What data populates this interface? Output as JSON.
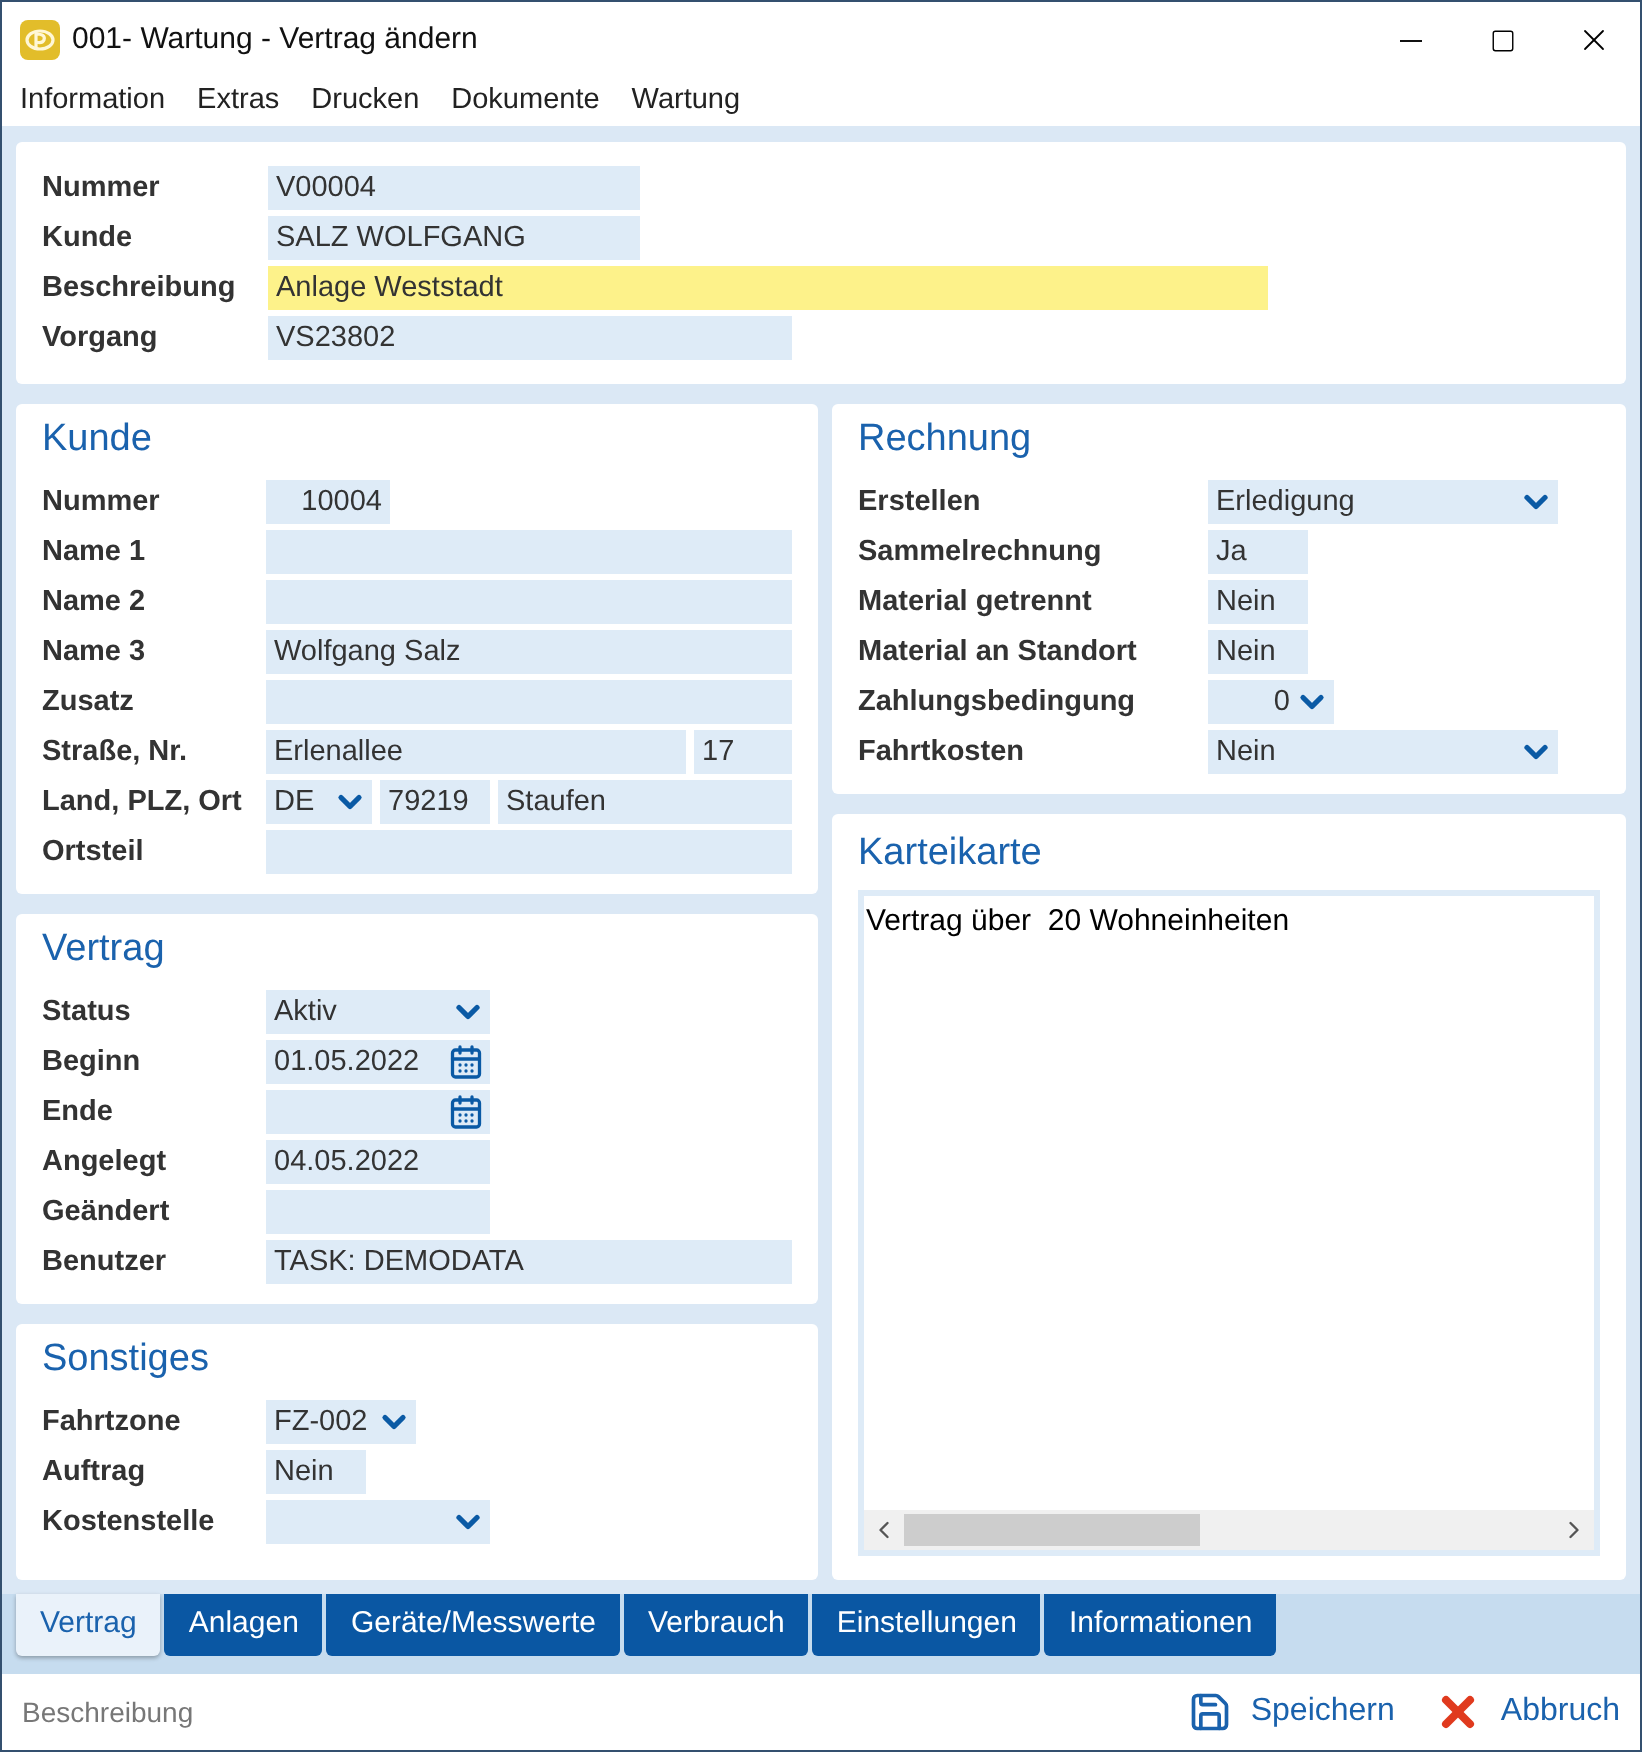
{
  "window": {
    "title": "001- Wartung - Vertrag ändern"
  },
  "menu": [
    "Information",
    "Extras",
    "Drucken",
    "Dokumente",
    "Wartung"
  ],
  "header": {
    "fields": [
      {
        "label": "Nummer",
        "value": "V00004",
        "focused": false
      },
      {
        "label": "Kunde",
        "value": "SALZ WOLFGANG",
        "focused": false
      },
      {
        "label": "Beschreibung",
        "value": "Anlage Weststadt",
        "focused": true
      },
      {
        "label": "Vorgang",
        "value": "VS23802",
        "focused": false
      }
    ]
  },
  "left_sections": [
    {
      "title": "Kunde",
      "fields": [
        {
          "label": "Nummer",
          "inputs": [
            {
              "kind": "number",
              "value": "10004"
            }
          ]
        },
        {
          "label": "Name 1",
          "inputs": [
            {
              "kind": "text"
            }
          ]
        },
        {
          "label": "Name 2",
          "inputs": [
            {
              "kind": "text"
            }
          ]
        },
        {
          "label": "Name 3",
          "inputs": [
            {
              "kind": "text",
              "value": "Wolfgang Salz"
            }
          ]
        },
        {
          "label": "Zusatz",
          "inputs": [
            {
              "kind": "text"
            }
          ]
        },
        {
          "label": "Straße, Nr.",
          "inputs": [
            {
              "kind": "text",
              "value": "Erlenallee"
            },
            {
              "kind": "text",
              "value": "17"
            }
          ]
        },
        {
          "label": "Land, PLZ, Ort",
          "inputs": [
            {
              "kind": "select",
              "value": "DE"
            },
            {
              "kind": "text",
              "value": "79219"
            },
            {
              "kind": "text",
              "value": "Staufen"
            }
          ]
        },
        {
          "label": "Ortsteil",
          "inputs": [
            {
              "kind": "text"
            }
          ]
        }
      ]
    },
    {
      "title": "Vertrag",
      "fields": [
        {
          "label": "Status",
          "inputs": [
            {
              "kind": "select",
              "value": "Aktiv"
            }
          ]
        },
        {
          "label": "Beginn",
          "inputs": [
            {
              "kind": "date",
              "value": "01.05.2022"
            }
          ]
        },
        {
          "label": "Ende",
          "inputs": [
            {
              "kind": "date"
            }
          ]
        },
        {
          "label": "Angelegt",
          "inputs": [
            {
              "kind": "text",
              "value": "04.05.2022"
            }
          ]
        },
        {
          "label": "Geändert",
          "inputs": [
            {
              "kind": "text"
            }
          ]
        },
        {
          "label": "Benutzer",
          "inputs": [
            {
              "kind": "text",
              "value": "TASK: DEMODATA"
            }
          ]
        }
      ]
    },
    {
      "title": "Sonstiges",
      "fields": [
        {
          "label": "Fahrtzone",
          "inputs": [
            {
              "kind": "select",
              "value": "FZ-002"
            }
          ]
        },
        {
          "label": "Auftrag",
          "inputs": [
            {
              "kind": "text",
              "value": "Nein"
            }
          ]
        },
        {
          "label": "Kostenstelle",
          "inputs": [
            {
              "kind": "select"
            }
          ]
        }
      ]
    }
  ],
  "right_sections": [
    {
      "title": "Rechnung",
      "fields": [
        {
          "label": "Erstellen",
          "inputs": [
            {
              "kind": "select",
              "value": "Erledigung"
            }
          ]
        },
        {
          "label": "Sammelrechnung",
          "inputs": [
            {
              "kind": "text",
              "value": "Ja"
            }
          ]
        },
        {
          "label": "Material getrennt",
          "inputs": [
            {
              "kind": "text",
              "value": "Nein"
            }
          ]
        },
        {
          "label": "Material an Standort",
          "inputs": [
            {
              "kind": "text",
              "value": "Nein"
            }
          ]
        },
        {
          "label": "Zahlungsbedingung",
          "inputs": [
            {
              "kind": "number_select",
              "value": "0"
            }
          ]
        },
        {
          "label": "Fahrtkosten",
          "inputs": [
            {
              "kind": "select",
              "value": "Nein"
            }
          ]
        }
      ]
    }
  ],
  "notes": {
    "title": "Karteikarte",
    "text": "Vertrag über  20 Wohneinheiten"
  },
  "tabs": [
    {
      "label": "Vertrag",
      "selected": true
    },
    {
      "label": "Anlagen",
      "selected": false
    },
    {
      "label": "Geräte/Messwerte",
      "selected": false
    },
    {
      "label": "Verbrauch",
      "selected": false
    },
    {
      "label": "Einstellungen",
      "selected": false
    },
    {
      "label": "Informationen",
      "selected": false
    }
  ],
  "status_bar": {
    "hint": "Beschreibung",
    "buttons": [
      {
        "kind": "save",
        "label": "Speichern"
      },
      {
        "kind": "cancel",
        "label": "Abbruch"
      }
    ]
  }
}
